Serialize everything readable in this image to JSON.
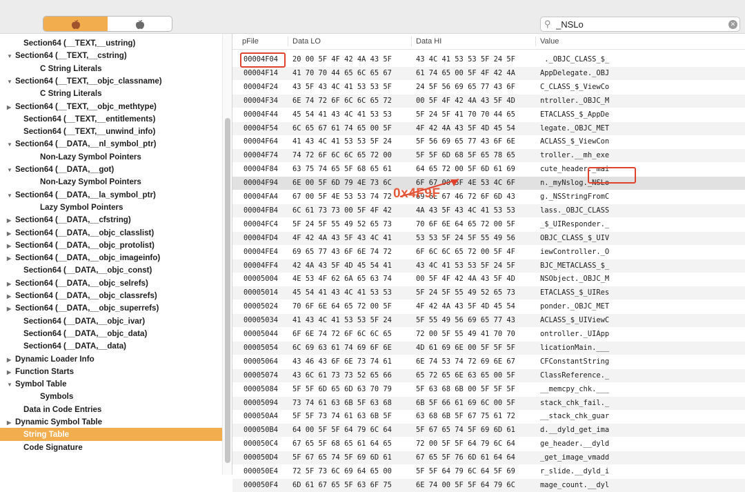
{
  "toolbar": {
    "seg_icons": [
      "apple-icon",
      "apple-icon"
    ],
    "search_value": "_NSLo",
    "accent": "#f2ad4e"
  },
  "sidebar": {
    "items": [
      {
        "label": "Section64 (__TEXT,__ustring)",
        "indent": 1,
        "disc": ""
      },
      {
        "label": "Section64 (__TEXT,__cstring)",
        "indent": 0,
        "disc": "▼"
      },
      {
        "label": "C String Literals",
        "indent": 2,
        "disc": ""
      },
      {
        "label": "Section64 (__TEXT,__objc_classname)",
        "indent": 0,
        "disc": "▼"
      },
      {
        "label": "C String Literals",
        "indent": 2,
        "disc": ""
      },
      {
        "label": "Section64 (__TEXT,__objc_methtype)",
        "indent": 0,
        "disc": "▶"
      },
      {
        "label": "Section64 (__TEXT,__entitlements)",
        "indent": 1,
        "disc": ""
      },
      {
        "label": "Section64 (__TEXT,__unwind_info)",
        "indent": 1,
        "disc": ""
      },
      {
        "label": "Section64 (__DATA,__nl_symbol_ptr)",
        "indent": 0,
        "disc": "▼"
      },
      {
        "label": "Non-Lazy Symbol Pointers",
        "indent": 2,
        "disc": ""
      },
      {
        "label": "Section64 (__DATA,__got)",
        "indent": 0,
        "disc": "▼"
      },
      {
        "label": "Non-Lazy Symbol Pointers",
        "indent": 2,
        "disc": ""
      },
      {
        "label": "Section64 (__DATA,__la_symbol_ptr)",
        "indent": 0,
        "disc": "▼"
      },
      {
        "label": "Lazy Symbol Pointers",
        "indent": 2,
        "disc": ""
      },
      {
        "label": "Section64 (__DATA,__cfstring)",
        "indent": 0,
        "disc": "▶"
      },
      {
        "label": "Section64 (__DATA,__objc_classlist)",
        "indent": 0,
        "disc": "▶"
      },
      {
        "label": "Section64 (__DATA,__objc_protolist)",
        "indent": 0,
        "disc": "▶"
      },
      {
        "label": "Section64 (__DATA,__objc_imageinfo)",
        "indent": 0,
        "disc": "▶"
      },
      {
        "label": "Section64 (__DATA,__objc_const)",
        "indent": 1,
        "disc": ""
      },
      {
        "label": "Section64 (__DATA,__objc_selrefs)",
        "indent": 0,
        "disc": "▶"
      },
      {
        "label": "Section64 (__DATA,__objc_classrefs)",
        "indent": 0,
        "disc": "▶"
      },
      {
        "label": "Section64 (__DATA,__objc_superrefs)",
        "indent": 0,
        "disc": "▶"
      },
      {
        "label": "Section64 (__DATA,__objc_ivar)",
        "indent": 1,
        "disc": ""
      },
      {
        "label": "Section64 (__DATA,__objc_data)",
        "indent": 1,
        "disc": ""
      },
      {
        "label": "Section64 (__DATA,__data)",
        "indent": 1,
        "disc": ""
      },
      {
        "label": "Dynamic Loader Info",
        "indent": 0,
        "disc": "▶"
      },
      {
        "label": "Function Starts",
        "indent": 0,
        "disc": "▶"
      },
      {
        "label": "Symbol Table",
        "indent": 0,
        "disc": "▼"
      },
      {
        "label": "Symbols",
        "indent": 2,
        "disc": ""
      },
      {
        "label": "Data in Code Entries",
        "indent": 1,
        "disc": ""
      },
      {
        "label": "Dynamic Symbol Table",
        "indent": 0,
        "disc": "▶"
      },
      {
        "label": "String Table",
        "indent": 1,
        "disc": "",
        "selected": true
      },
      {
        "label": "Code Signature",
        "indent": 1,
        "disc": ""
      }
    ]
  },
  "table": {
    "headers": [
      "pFile",
      "Data LO",
      "Data HI",
      "Value"
    ],
    "rows": [
      [
        "00004F04",
        "20 00 5F 4F 42 4A 43 5F",
        "43 4C 41 53 53 5F 24 5F",
        " ._OBJC_CLASS_$_"
      ],
      [
        "00004F14",
        "41 70 70 44 65 6C 65 67",
        "61 74 65 00 5F 4F 42 4A",
        "AppDelegate._OBJ"
      ],
      [
        "00004F24",
        "43 5F 43 4C 41 53 53 5F",
        "24 5F 56 69 65 77 43 6F",
        "C_CLASS_$_ViewCo"
      ],
      [
        "00004F34",
        "6E 74 72 6F 6C 6C 65 72",
        "00 5F 4F 42 4A 43 5F 4D",
        "ntroller._OBJC_M"
      ],
      [
        "00004F44",
        "45 54 41 43 4C 41 53 53",
        "5F 24 5F 41 70 70 44 65",
        "ETACLASS_$_AppDe"
      ],
      [
        "00004F54",
        "6C 65 67 61 74 65 00 5F",
        "4F 42 4A 43 5F 4D 45 54",
        "legate._OBJC_MET"
      ],
      [
        "00004F64",
        "41 43 4C 41 53 53 5F 24",
        "5F 56 69 65 77 43 6F 6E",
        "ACLASS_$_ViewCon"
      ],
      [
        "00004F74",
        "74 72 6F 6C 6C 65 72 00",
        "5F 5F 6D 68 5F 65 78 65",
        "troller.__mh_exe"
      ],
      [
        "00004F84",
        "63 75 74 65 5F 68 65 61",
        "64 65 72 00 5F 6D 61 69",
        "cute_header._mai"
      ],
      [
        "00004F94",
        "6E 00 5F 6D 79 4E 73 6C",
        "6F 67 00 5F 4E 53 4C 6F",
        "n._myNslog._NSLo"
      ],
      [
        "00004FA4",
        "67 00 5F 4E 53 53 74 72",
        "69 6E 67 46 72 6F 6D 43",
        "g._NSStringFromC"
      ],
      [
        "00004FB4",
        "6C 61 73 73 00 5F 4F 42",
        "4A 43 5F 43 4C 41 53 53",
        "lass._OBJC_CLASS"
      ],
      [
        "00004FC4",
        "5F 24 5F 55 49 52 65 73",
        "70 6F 6E 64 65 72 00 5F",
        "_$_UIResponder._"
      ],
      [
        "00004FD4",
        "4F 42 4A 43 5F 43 4C 41",
        "53 53 5F 24 5F 55 49 56",
        "OBJC_CLASS_$_UIV"
      ],
      [
        "00004FE4",
        "69 65 77 43 6F 6E 74 72",
        "6F 6C 6C 65 72 00 5F 4F",
        "iewController._O"
      ],
      [
        "00004FF4",
        "42 4A 43 5F 4D 45 54 41",
        "43 4C 41 53 53 5F 24 5F",
        "BJC_METACLASS_$_"
      ],
      [
        "00005004",
        "4E 53 4F 62 6A 65 63 74",
        "00 5F 4F 42 4A 43 5F 4D",
        "NSObject._OBJC_M"
      ],
      [
        "00005014",
        "45 54 41 43 4C 41 53 53",
        "5F 24 5F 55 49 52 65 73",
        "ETACLASS_$_UIRes"
      ],
      [
        "00005024",
        "70 6F 6E 64 65 72 00 5F",
        "4F 42 4A 43 5F 4D 45 54",
        "ponder._OBJC_MET"
      ],
      [
        "00005034",
        "41 43 4C 41 53 53 5F 24",
        "5F 55 49 56 69 65 77 43",
        "ACLASS_$_UIViewC"
      ],
      [
        "00005044",
        "6F 6E 74 72 6F 6C 6C 65",
        "72 00 5F 55 49 41 70 70",
        "ontroller._UIApp"
      ],
      [
        "00005054",
        "6C 69 63 61 74 69 6F 6E",
        "4D 61 69 6E 00 5F 5F 5F",
        "licationMain.___"
      ],
      [
        "00005064",
        "43 46 43 6F 6E 73 74 61",
        "6E 74 53 74 72 69 6E 67",
        "CFConstantString"
      ],
      [
        "00005074",
        "43 6C 61 73 73 52 65 66",
        "65 72 65 6E 63 65 00 5F",
        "ClassReference._"
      ],
      [
        "00005084",
        "5F 5F 6D 65 6D 63 70 79",
        "5F 63 68 6B 00 5F 5F 5F",
        "__memcpy_chk.___"
      ],
      [
        "00005094",
        "73 74 61 63 6B 5F 63 68",
        "6B 5F 66 61 69 6C 00 5F",
        "stack_chk_fail._"
      ],
      [
        "000050A4",
        "5F 5F 73 74 61 63 6B 5F",
        "63 68 6B 5F 67 75 61 72",
        "__stack_chk_guar"
      ],
      [
        "000050B4",
        "64 00 5F 5F 64 79 6C 64",
        "5F 67 65 74 5F 69 6D 61",
        "d.__dyld_get_ima"
      ],
      [
        "000050C4",
        "67 65 5F 68 65 61 64 65",
        "72 00 5F 5F 64 79 6C 64",
        "ge_header.__dyld"
      ],
      [
        "000050D4",
        "5F 67 65 74 5F 69 6D 61",
        "67 65 5F 76 6D 61 64 64",
        "_get_image_vmadd"
      ],
      [
        "000050E4",
        "72 5F 73 6C 69 64 65 00",
        "5F 5F 64 79 6C 64 5F 69",
        "r_slide.__dyld_i"
      ],
      [
        "000050F4",
        "6D 61 67 65 5F 63 6F 75",
        "6E 74 00 5F 5F 64 79 6C",
        "mage_count.__dyl"
      ]
    ],
    "selected_row": 9
  },
  "annotation": {
    "label": "0x4F9F",
    "color": "#e0412c"
  }
}
